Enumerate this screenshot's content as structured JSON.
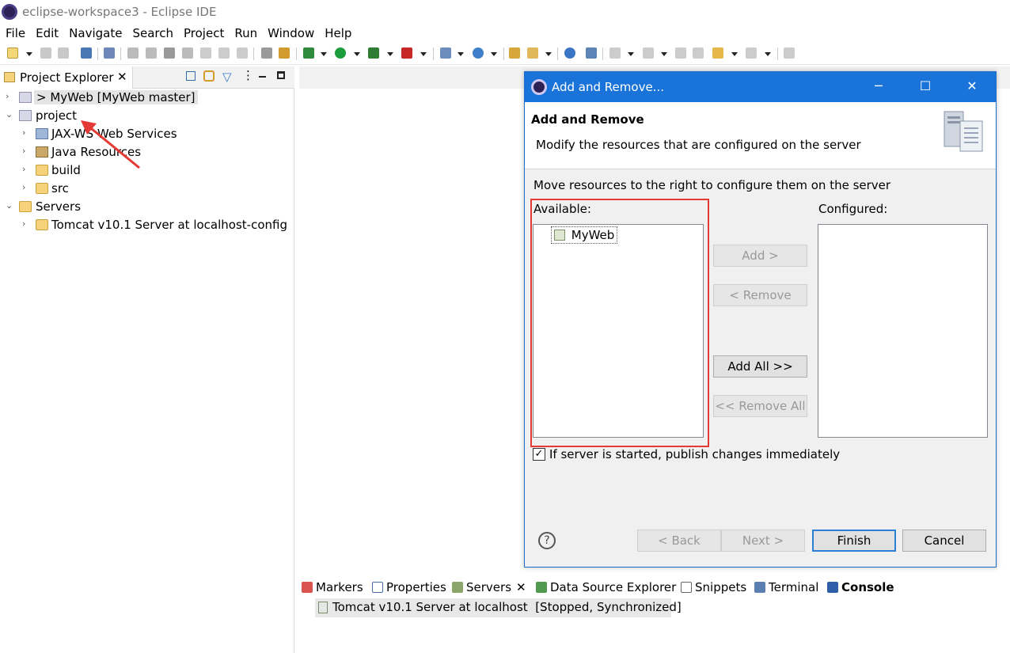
{
  "window": {
    "title": "eclipse-workspace3 - Eclipse IDE"
  },
  "menu": [
    "File",
    "Edit",
    "Navigate",
    "Search",
    "Project",
    "Run",
    "Window",
    "Help"
  ],
  "explorer": {
    "tab_label": "Project Explorer",
    "tree": [
      {
        "label": "> MyWeb [MyWeb master]",
        "twisty": "›",
        "level": 0,
        "icon": "web-project-icon"
      },
      {
        "label": "project",
        "twisty": "⌄",
        "level": 0,
        "icon": "web-project-icon"
      },
      {
        "label": "JAX-WS Web Services",
        "twisty": "›",
        "level": 1,
        "icon": "web-services-icon"
      },
      {
        "label": "Java Resources",
        "twisty": "›",
        "level": 1,
        "icon": "java-resources-icon"
      },
      {
        "label": "build",
        "twisty": "›",
        "level": 1,
        "icon": "folder-icon"
      },
      {
        "label": "src",
        "twisty": "›",
        "level": 1,
        "icon": "folder-icon"
      },
      {
        "label": "Servers",
        "twisty": "⌄",
        "level": 0,
        "icon": "folder-icon"
      },
      {
        "label": "Tomcat v10.1 Server at localhost-config",
        "twisty": "›",
        "level": 1,
        "icon": "folder-icon"
      }
    ]
  },
  "dialog": {
    "title": "Add and Remove...",
    "header_title": "Add and Remove",
    "header_desc": "Modify the resources that are configured on the server",
    "instruction": "Move resources to the right to configure them on the server",
    "available_label": "Available:",
    "configured_label": "Configured:",
    "available_items": [
      "MyWeb"
    ],
    "buttons": {
      "add": "Add >",
      "remove": "< Remove",
      "add_all": "Add All >>",
      "remove_all": "<< Remove All",
      "back": "< Back",
      "next": "Next >",
      "finish": "Finish",
      "cancel": "Cancel"
    },
    "publish_checkbox": {
      "label": "If server is started, publish changes immediately",
      "checked": true
    }
  },
  "bottom_panel": {
    "tabs": [
      "Markers",
      "Properties",
      "Servers",
      "Data Source Explorer",
      "Snippets",
      "Terminal",
      "Console"
    ],
    "server_entry": "Tomcat v10.1 Server at localhost  [Stopped, Synchronized]"
  },
  "colors": {
    "accent": "#1a73d9",
    "highlight_box": "#e53935",
    "arrow": "#e53935"
  }
}
